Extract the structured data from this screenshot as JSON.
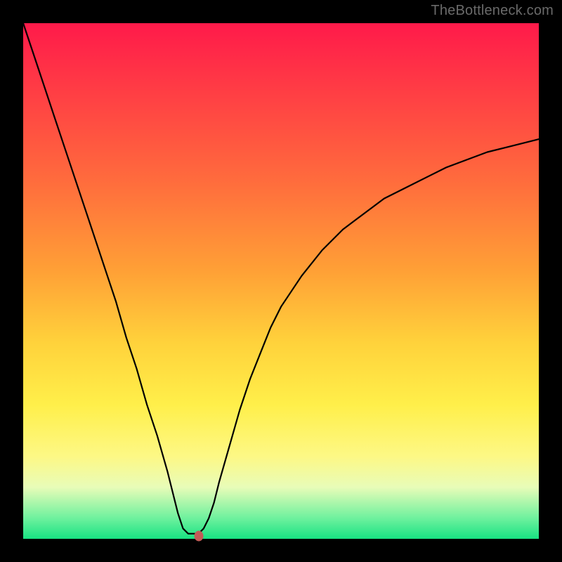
{
  "watermark": "TheBottleneck.com",
  "chart_data": {
    "type": "line",
    "title": "",
    "xlabel": "",
    "ylabel": "",
    "x_range": [
      0,
      100
    ],
    "y_range": [
      0,
      100
    ],
    "series": [
      {
        "name": "curve",
        "x": [
          0,
          2,
          4,
          6,
          8,
          10,
          12,
          14,
          16,
          18,
          20,
          22,
          24,
          26,
          28,
          30,
          31,
          32,
          33,
          34,
          35,
          36,
          37,
          38,
          40,
          42,
          44,
          46,
          48,
          50,
          54,
          58,
          62,
          66,
          70,
          74,
          78,
          82,
          86,
          90,
          94,
          98,
          100
        ],
        "y": [
          100,
          94,
          88,
          82,
          76,
          70,
          64,
          58,
          52,
          46,
          39,
          33,
          26,
          20,
          13,
          5,
          2,
          1,
          1,
          1,
          2,
          4,
          7,
          11,
          18,
          25,
          31,
          36,
          41,
          45,
          51,
          56,
          60,
          63,
          66,
          68,
          70,
          72,
          73.5,
          75,
          76,
          77,
          77.5
        ]
      }
    ],
    "marker": {
      "x": 34,
      "y": 0.5,
      "color": "#c35c57"
    },
    "gradient_stops": [
      {
        "pos": 0.0,
        "color": "#ff1a4a"
      },
      {
        "pos": 0.12,
        "color": "#ff3a45"
      },
      {
        "pos": 0.3,
        "color": "#ff6a3d"
      },
      {
        "pos": 0.48,
        "color": "#ffa036"
      },
      {
        "pos": 0.62,
        "color": "#ffd23b"
      },
      {
        "pos": 0.74,
        "color": "#ffef4a"
      },
      {
        "pos": 0.84,
        "color": "#fdf885"
      },
      {
        "pos": 0.9,
        "color": "#e8fcb8"
      },
      {
        "pos": 0.96,
        "color": "#6ef19e"
      },
      {
        "pos": 1.0,
        "color": "#18e282"
      }
    ]
  }
}
